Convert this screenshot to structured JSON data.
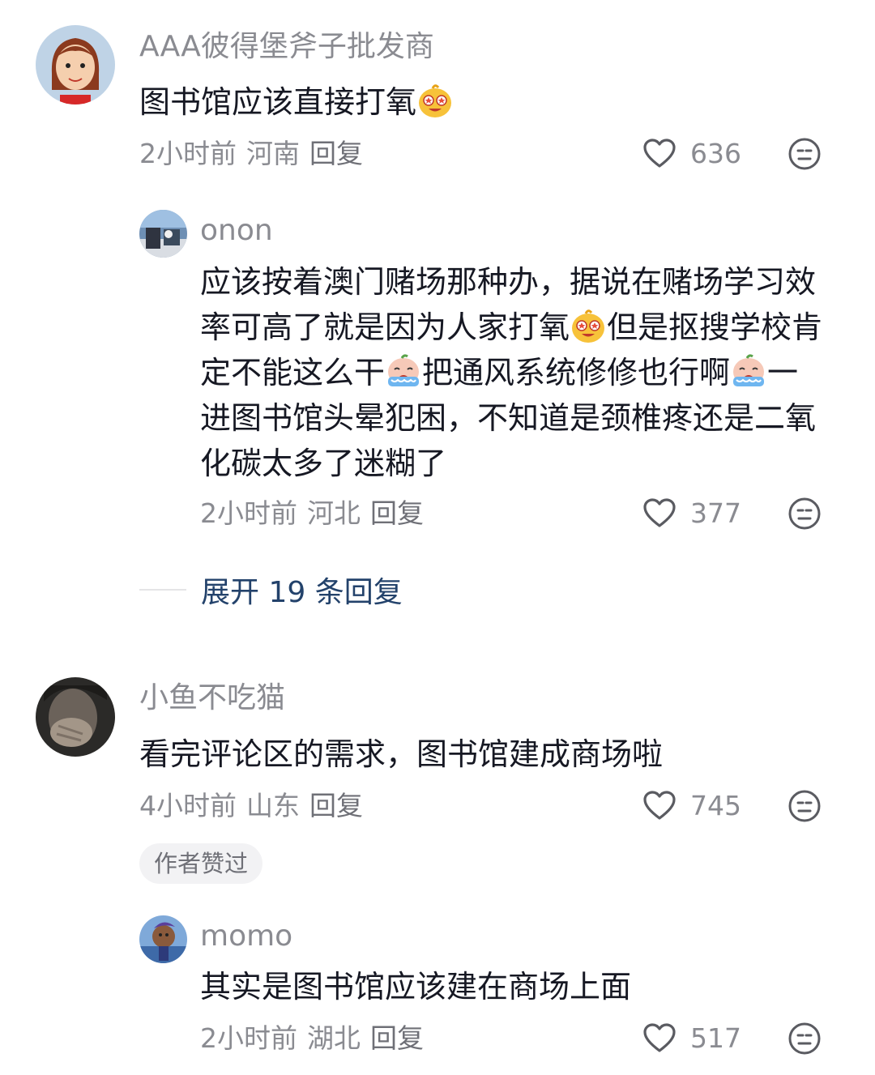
{
  "comments": [
    {
      "username": "AAA彼得堡斧子批发商",
      "text": "图书馆应该直接打氧",
      "time": "2小时前",
      "location": "河南",
      "reply_label": "回复",
      "likes": "636"
    },
    {
      "username": "onon",
      "text_parts": [
        "应该按着澳门赌场那种办，据说在赌场学习效率可高了就是因为人家打氧",
        "但是抠搜学校肯定不能这么干",
        "把通风系统修修也行啊",
        "一进图书馆头晕犯困，不知道是颈椎疼还是二氧化碳太多了迷糊了"
      ],
      "time": "2小时前",
      "location": "河北",
      "reply_label": "回复",
      "likes": "377"
    },
    {
      "username": "小鱼不吃猫",
      "text": "看完评论区的需求，图书馆建成商场啦",
      "time": "4小时前",
      "location": "山东",
      "reply_label": "回复",
      "likes": "745"
    },
    {
      "username": "momo",
      "text": "其实是图书馆应该建在商场上面",
      "time": "2小时前",
      "location": "湖北",
      "reply_label": "回复",
      "likes": "517"
    }
  ],
  "expand_replies": "展开 19 条回复",
  "author_liked_badge": "作者赞过",
  "colors": {
    "secondary_text": "#8a8b91",
    "link": "#23426b",
    "badge_bg": "#f2f2f4"
  },
  "icons": [
    "heart-outline-icon",
    "dislike-face-icon",
    "laughing-emoji-icon",
    "crying-emoji-icon"
  ]
}
